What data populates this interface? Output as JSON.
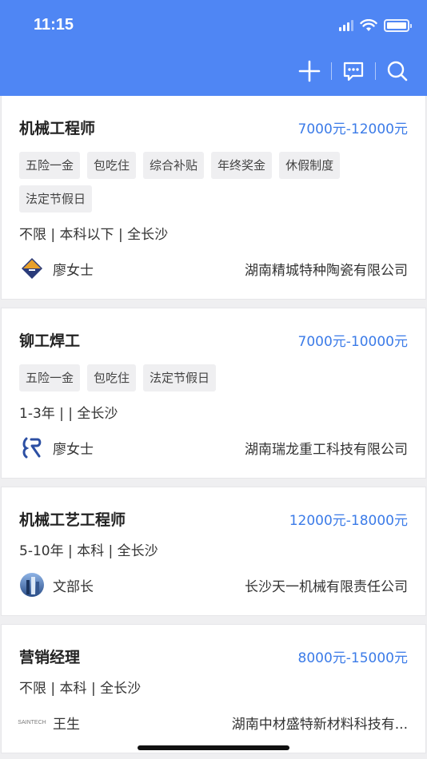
{
  "status": {
    "time": "11:15"
  },
  "toolbar": {
    "add_icon": "plus-icon",
    "message_icon": "chat-icon",
    "search_icon": "search-icon"
  },
  "colors": {
    "header": "#4f86f4",
    "salary": "#3b7be8",
    "tag_bg": "#efeff1"
  },
  "jobs": [
    {
      "title": "机械工程师",
      "salary": "7000元-12000元",
      "tags": [
        "五险一金",
        "包吃住",
        "综合补贴",
        "年终奖金",
        "休假制度",
        "法定节假日"
      ],
      "requirements": "不限 | 本科以下 | 全长沙",
      "contact": "廖女士",
      "company": "湖南精城特种陶瓷有限公司",
      "logo": "company-logo-jingcheng"
    },
    {
      "title": "铆工焊工",
      "salary": "7000元-10000元",
      "tags": [
        "五险一金",
        "包吃住",
        "法定节假日"
      ],
      "requirements": "1-3年 |  | 全长沙",
      "contact": "廖女士",
      "company": "湖南瑞龙重工科技有限公司",
      "logo": "company-logo-ruilong"
    },
    {
      "title": "机械工艺工程师",
      "salary": "12000元-18000元",
      "tags": [],
      "requirements": "5-10年 | 本科 | 全长沙",
      "contact": "文部长",
      "company": "长沙天一机械有限责任公司",
      "logo": "company-logo-tianyi"
    },
    {
      "title": "营销经理",
      "salary": "8000元-15000元",
      "tags": [],
      "requirements": "不限 | 本科 | 全长沙",
      "contact": "王生",
      "company": "湖南中材盛特新材料科技有...",
      "logo": "company-logo-saintech",
      "logo_text": "SAINTECH"
    }
  ]
}
